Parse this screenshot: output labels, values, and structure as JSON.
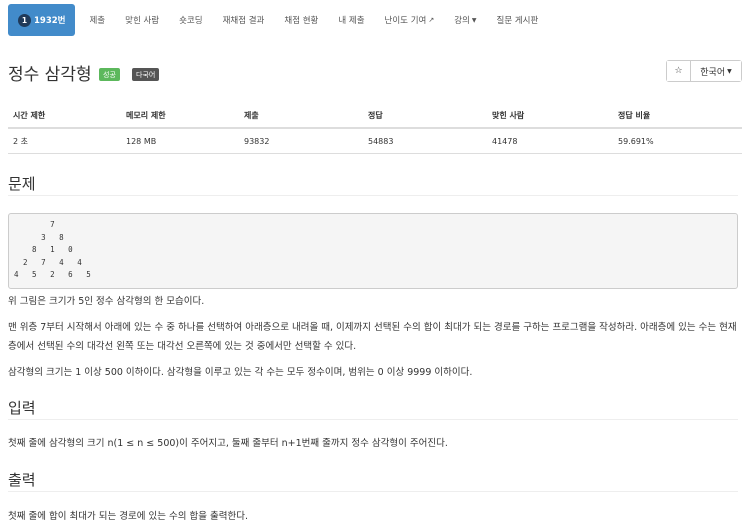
{
  "nav": {
    "problem_badge": "1",
    "problem_number": "1932번",
    "items": [
      "제출",
      "맞힌 사람",
      "숏코딩",
      "재채점 결과",
      "채점 현황",
      "내 제출",
      "난이도 기여",
      "강의",
      "질문 게시판"
    ]
  },
  "title": {
    "text": "정수 삼각형",
    "label_success": "성공",
    "label_multilang": "다국어",
    "star": "☆",
    "language": "한국어"
  },
  "info": {
    "headers": [
      "시간 제한",
      "메모리 제한",
      "제출",
      "정답",
      "맞힌 사람",
      "정답 비율"
    ],
    "values": [
      "2 초",
      "128 MB",
      "93832",
      "54883",
      "41478",
      "59.691%"
    ]
  },
  "problem": {
    "heading": "문제",
    "triangle": "        7\n      3   8\n    8   1   0\n  2   7   4   4\n4   5   2   6   5",
    "p1": "위 그림은 크기가 5인 정수 삼각형의 한 모습이다.",
    "p2": "맨 위층 7부터 시작해서 아래에 있는 수 중 하나를 선택하여 아래층으로 내려올 때, 이제까지 선택된 수의 합이 최대가 되는 경로를 구하는 프로그램을 작성하라. 아래층에 있는 수는 현재 층에서 선택된 수의 대각선 왼쪽 또는 대각선 오른쪽에 있는 것 중에서만 선택할 수 있다.",
    "p3": "삼각형의 크기는 1 이상 500 이하이다. 삼각형을 이루고 있는 각 수는 모두 정수이며, 범위는 0 이상 9999 이하이다."
  },
  "input": {
    "heading": "입력",
    "p1": "첫째 줄에 삼각형의 크기 n(1 ≤ n ≤ 500)이 주어지고, 둘째 줄부터 n+1번째 줄까지 정수 삼각형이 주어진다."
  },
  "output": {
    "heading": "출력",
    "p1": "첫째 줄에 합이 최대가 되는 경로에 있는 수의 합을 출력한다."
  }
}
